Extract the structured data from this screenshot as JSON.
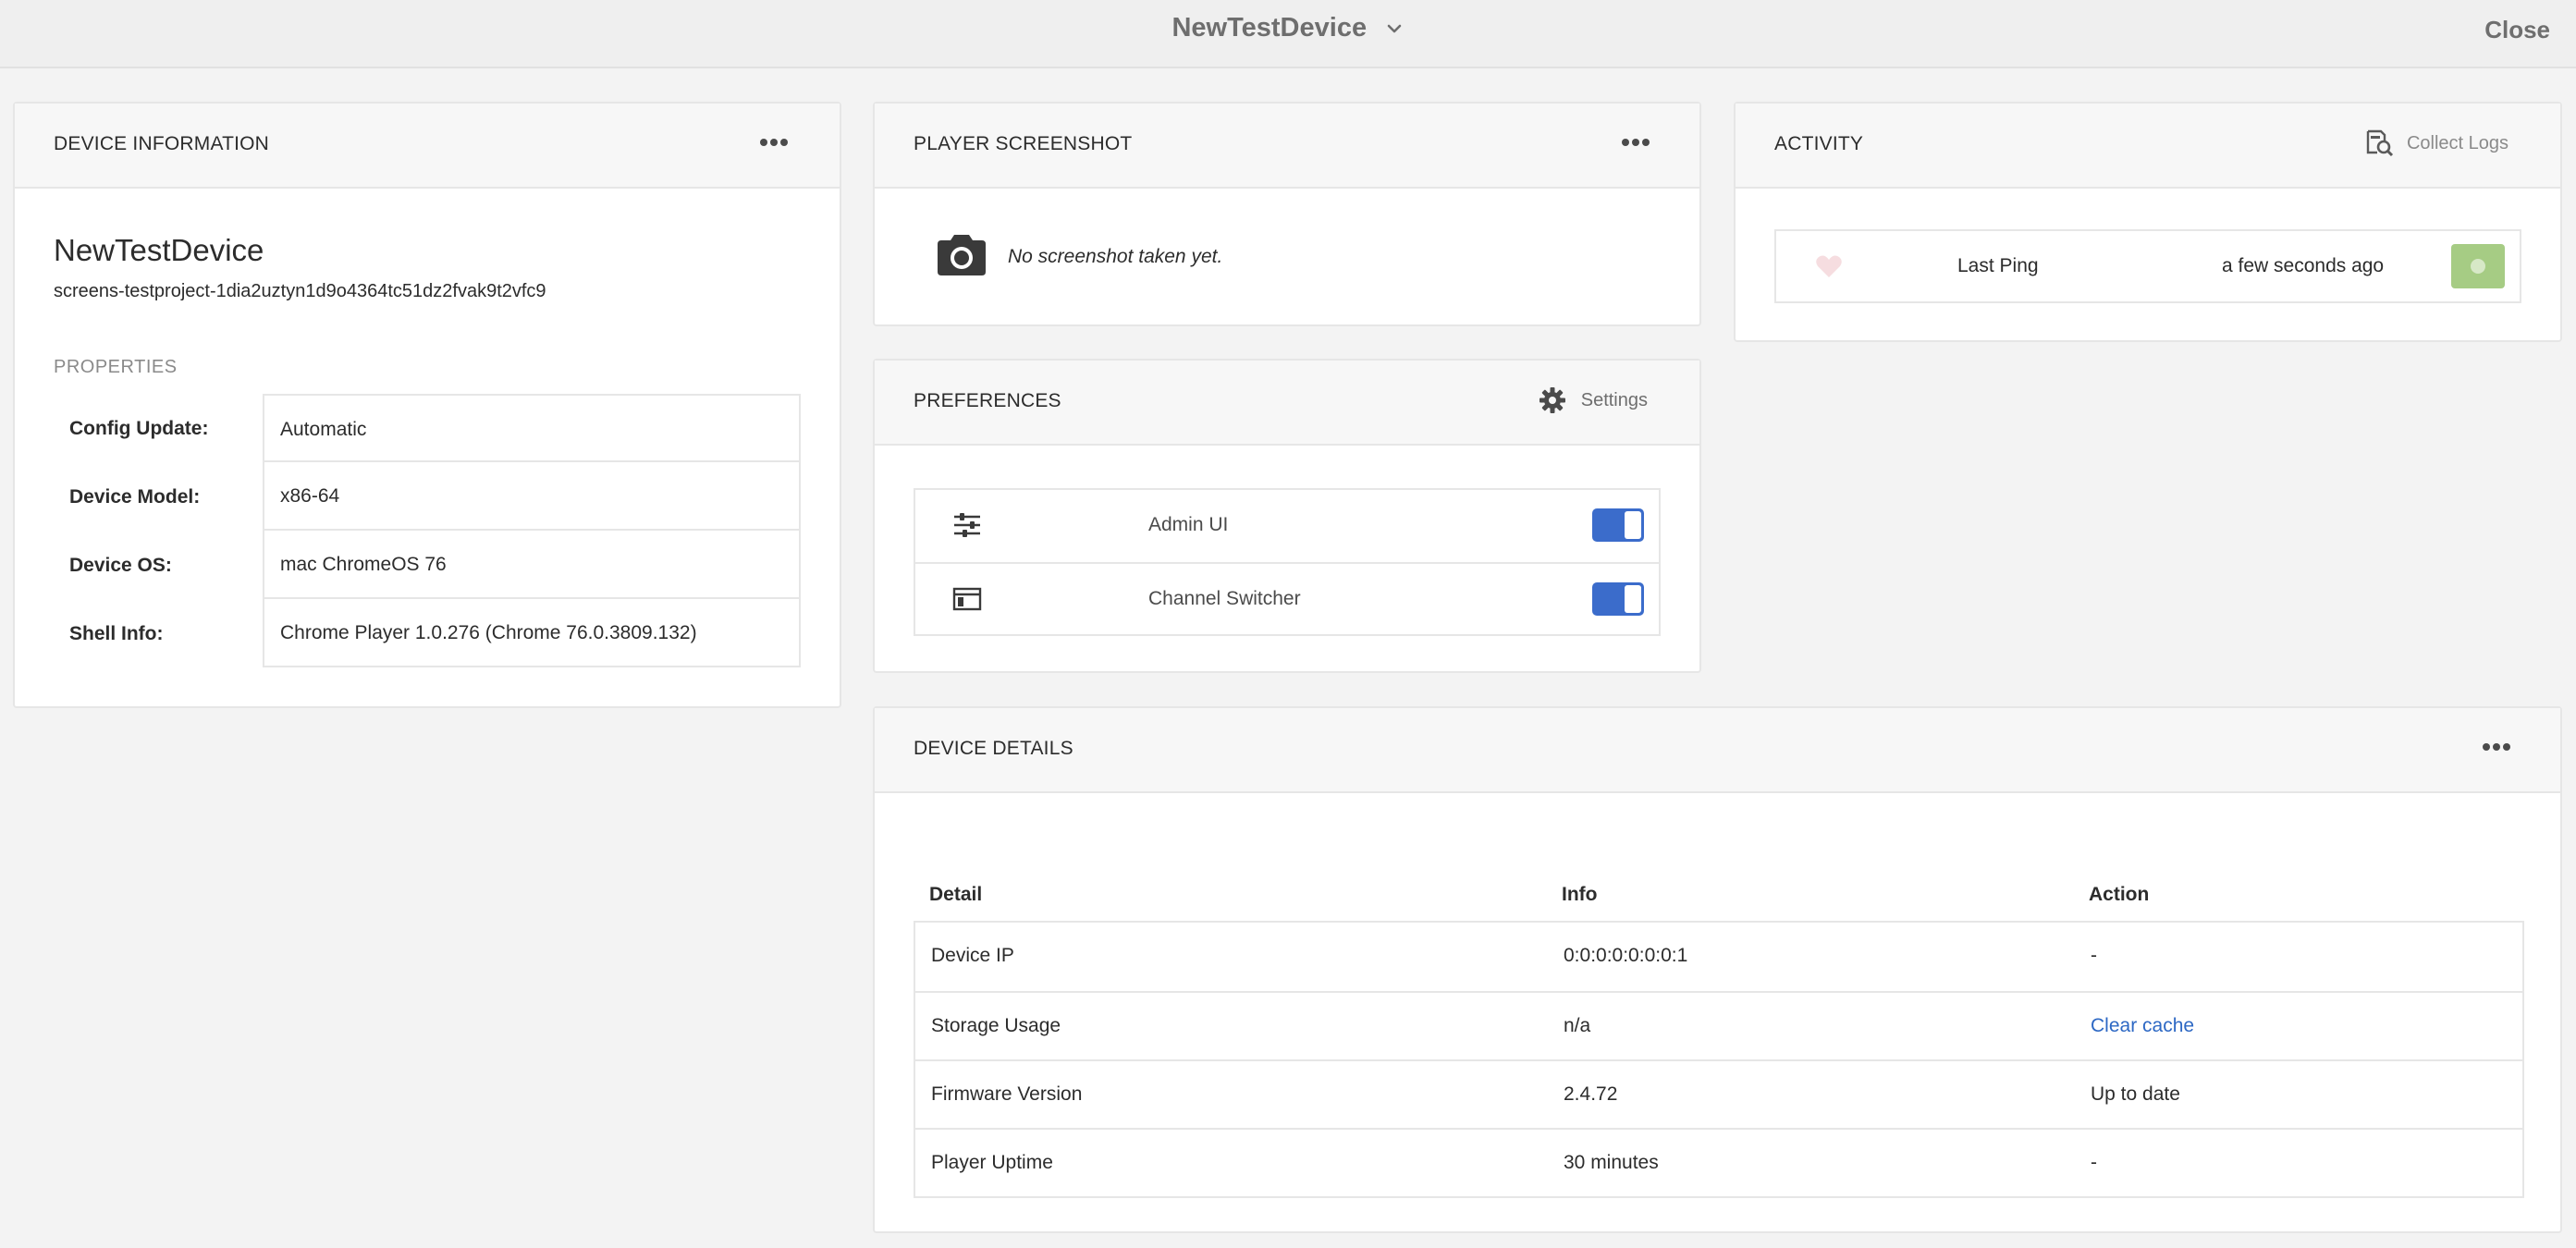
{
  "topbar": {
    "title": "NewTestDevice",
    "close_label": "Close"
  },
  "device_information": {
    "title": "DEVICE INFORMATION",
    "name": "NewTestDevice",
    "id": "screens-testproject-1dia2uztyn1d9o4364tc51dz2fvak9t2vfc9",
    "properties_title": "PROPERTIES",
    "properties": [
      {
        "key": "Config Update:",
        "value": "Automatic"
      },
      {
        "key": "Device Model:",
        "value": "x86-64"
      },
      {
        "key": "Device OS:",
        "value": "mac ChromeOS 76"
      },
      {
        "key": "Shell Info:",
        "value": "Chrome Player 1.0.276 (Chrome 76.0.3809.132)"
      }
    ]
  },
  "player_screenshot": {
    "title": "PLAYER SCREENSHOT",
    "empty_text": "No screenshot taken yet."
  },
  "preferences": {
    "title": "PREFERENCES",
    "settings_label": "Settings",
    "items": [
      {
        "label": "Admin UI",
        "icon": "sliders-icon",
        "enabled": true
      },
      {
        "label": "Channel Switcher",
        "icon": "channel-switcher-icon",
        "enabled": true
      }
    ]
  },
  "activity": {
    "title": "ACTIVITY",
    "collect_logs_label": "Collect Logs",
    "ping": {
      "label": "Last Ping",
      "time": "a few seconds ago",
      "status_color": "#a6cc84"
    }
  },
  "device_details": {
    "title": "DEVICE DETAILS",
    "columns": [
      "Detail",
      "Info",
      "Action"
    ],
    "rows": [
      {
        "detail": "Device IP",
        "info": "0:0:0:0:0:0:0:1",
        "action": "-"
      },
      {
        "detail": "Storage Usage",
        "info": "n/a",
        "action": "Clear cache"
      },
      {
        "detail": "Firmware Version",
        "info": "2.4.72",
        "action": "Up to date"
      },
      {
        "detail": "Player Uptime",
        "info": "30 minutes",
        "action": "-"
      }
    ]
  },
  "colors": {
    "accent": "#3b6ccb",
    "link": "#2d68c4",
    "status_ok": "#a6cc84",
    "background": "#f3f3f3"
  }
}
